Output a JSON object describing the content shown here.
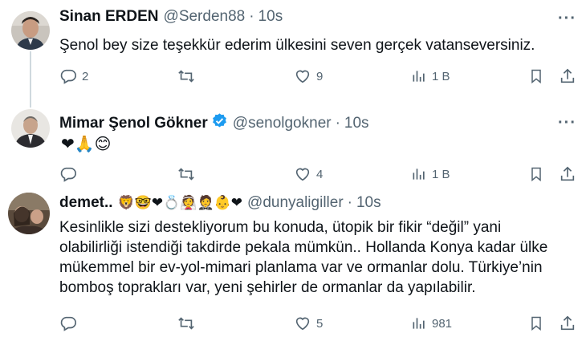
{
  "tweets": [
    {
      "name": "Sinan ERDEN",
      "handle": "@Serden88",
      "separator": "·",
      "time": "10s",
      "text": "Şenol bey size teşekkür ederim ülkesini seven gerçek vatanseversiniz.",
      "replies": "2",
      "retweets": "",
      "likes": "9",
      "views": "1 B",
      "more": "···"
    },
    {
      "name": "Mimar Şenol Gökner",
      "handle": "@senolgokner",
      "separator": "·",
      "time": "10s",
      "text": "❤🙏😊",
      "replies": "",
      "retweets": "",
      "likes": "4",
      "views": "1 B",
      "more": "···"
    },
    {
      "name": "demet..",
      "name_emojis": "🦁🤓❤💍👰🤵👶❤",
      "handle": "@dunyaligiller",
      "separator": "·",
      "time": "10s",
      "text_lines": [
        "Kesinlikle sizi destekliyorum bu konuda, ütopik bir fikir “değil” yani",
        "olabilirliği istendiği takdirde pekala mümkün.. Hollanda Konya kadar ülke",
        "mükemmel bir ev-yol-mimari planlama var ve ormanlar dolu. Türkiye’nin",
        "bomboş toprakları var, yeni şehirler de ormanlar da yapılabilir."
      ],
      "replies": "",
      "retweets": "",
      "likes": "5",
      "views": "981"
    }
  ],
  "icons": [
    "reply-icon",
    "retweet-icon",
    "like-icon",
    "views-icon",
    "bookmark-icon",
    "share-icon",
    "verified-icon",
    "more-icon"
  ],
  "colors": {
    "text": "#0f1419",
    "secondary": "#536471",
    "verified": "#1d9bf0",
    "line": "#cfd9de"
  }
}
